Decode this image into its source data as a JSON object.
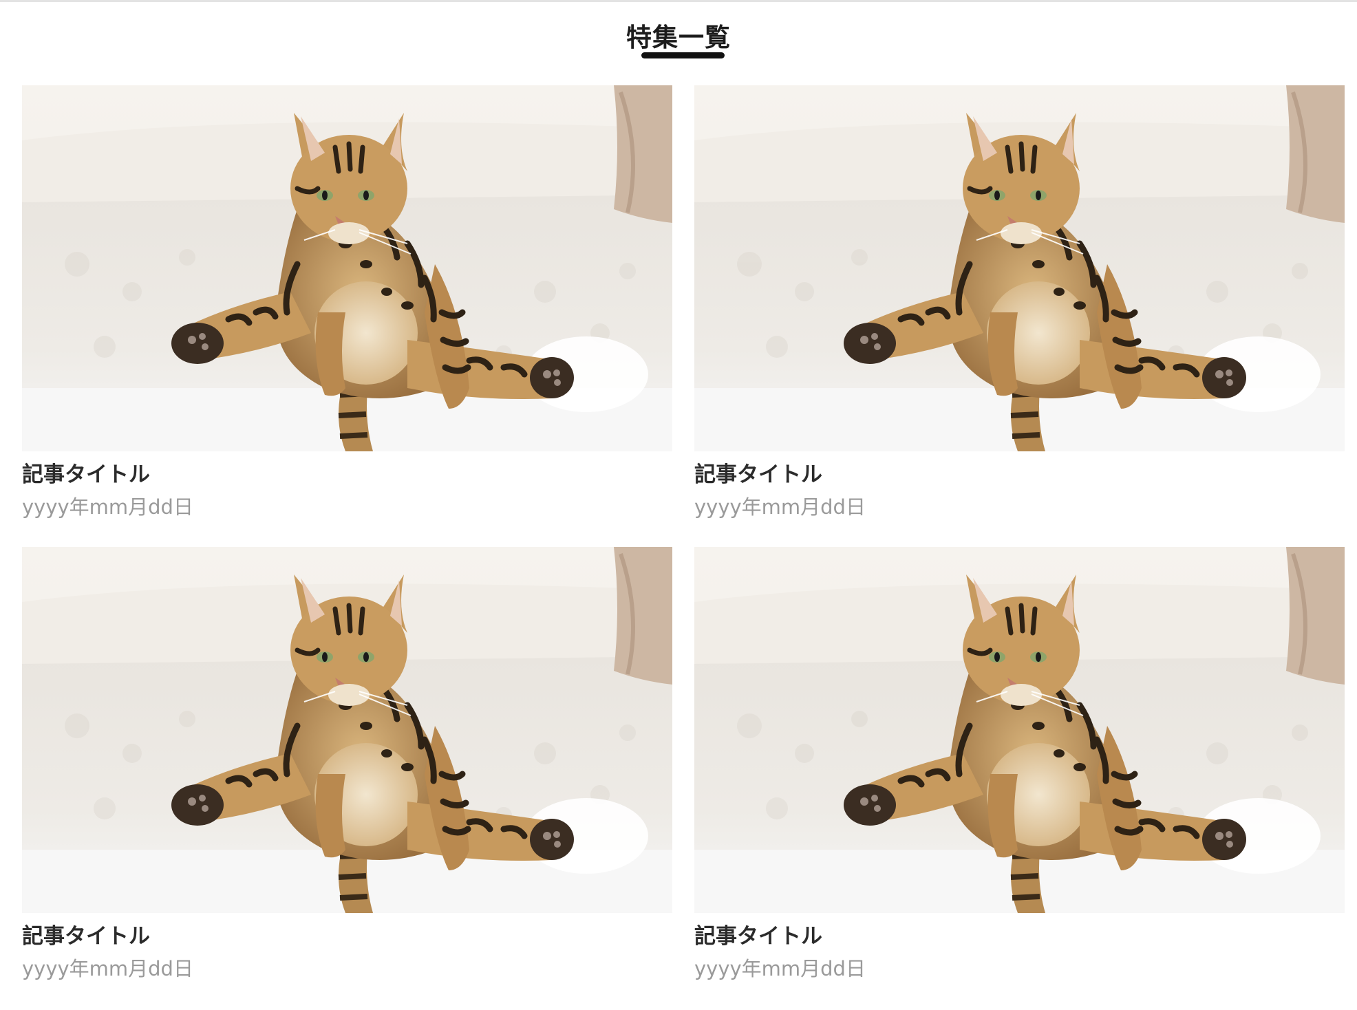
{
  "header": {
    "title": "特集一覧"
  },
  "cards": [
    {
      "title": "記事タイトル",
      "date": "yyyy年mm月dd日",
      "image": "cat-photo"
    },
    {
      "title": "記事タイトル",
      "date": "yyyy年mm月dd日",
      "image": "cat-photo"
    },
    {
      "title": "記事タイトル",
      "date": "yyyy年mm月dd日",
      "image": "cat-photo"
    },
    {
      "title": "記事タイトル",
      "date": "yyyy年mm月dd日",
      "image": "cat-photo"
    }
  ],
  "colors": {
    "title_text": "#1c1c1c",
    "underline": "#111111",
    "card_title": "#2b2b2b",
    "card_date": "#9a9a9a",
    "background": "#ffffff"
  }
}
